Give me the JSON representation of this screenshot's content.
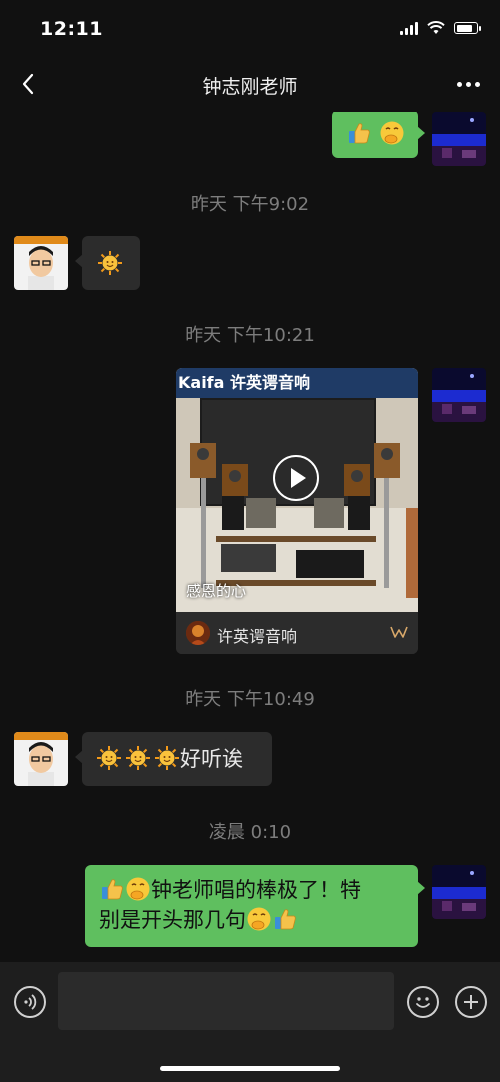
{
  "status_bar": {
    "time": "12:11"
  },
  "header": {
    "title": "钟志刚老师"
  },
  "messages": [
    {
      "type": "emoji",
      "side": "right",
      "emojis": [
        "thumbs-up",
        "hand-over-mouth"
      ]
    },
    {
      "type": "timestamp",
      "text": "昨天 下午9:02"
    },
    {
      "type": "emoji",
      "side": "left",
      "emojis": [
        "sun-face"
      ]
    },
    {
      "type": "timestamp",
      "text": "昨天 下午10:21"
    },
    {
      "type": "video-card",
      "side": "right",
      "caption": "感恩的心",
      "channel": "许英谔音响",
      "banner_text": "Kaifa 许英谔音响"
    },
    {
      "type": "timestamp",
      "text": "昨天 下午10:49"
    },
    {
      "type": "text",
      "side": "left",
      "emojis": [
        "sun-face",
        "sun-face",
        "sun-face"
      ],
      "text": "好听诶"
    },
    {
      "type": "timestamp",
      "text": "凌晨 0:10"
    },
    {
      "type": "text",
      "side": "right",
      "line1_text": "钟老师唱的棒极了！特",
      "line2_text": "别是开头那几句",
      "line1_emojis": [
        "thumbs-up",
        "hand-over-mouth"
      ],
      "line2_emojis": [
        "hand-over-mouth",
        "thumbs-up"
      ]
    }
  ],
  "input": {
    "placeholder": ""
  },
  "colors": {
    "background": "#111111",
    "sent_bubble": "#5fbf5f",
    "received_bubble": "#2c2c2c",
    "timestamp": "#7d7d7d"
  },
  "icons": {
    "back": "chevron-left-icon",
    "more": "more-dots-icon",
    "voice": "voice-icon",
    "emoji": "smiley-icon",
    "plus": "plus-icon"
  }
}
